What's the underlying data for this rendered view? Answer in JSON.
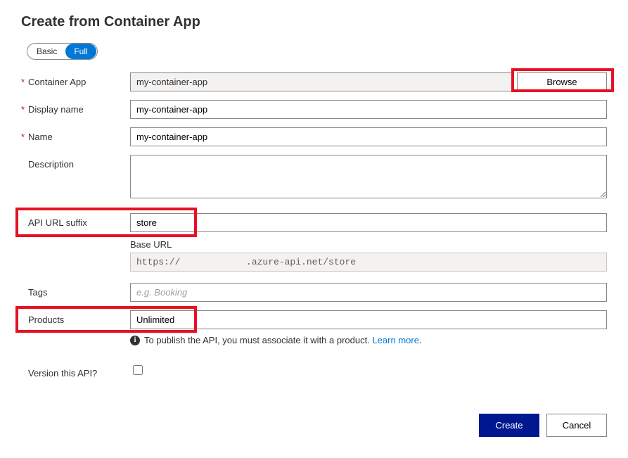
{
  "page": {
    "title": "Create from Container App"
  },
  "toggle": {
    "basic": "Basic",
    "full": "Full"
  },
  "labels": {
    "containerApp": "Container App",
    "displayName": "Display name",
    "name": "Name",
    "description": "Description",
    "apiUrlSuffix": "API URL suffix",
    "baseUrl": "Base URL",
    "tags": "Tags",
    "products": "Products",
    "version": "Version this API?"
  },
  "values": {
    "containerApp": "my-container-app",
    "displayName": "my-container-app",
    "name": "my-container-app",
    "description": "",
    "apiUrlSuffix": "store",
    "baseUrl": "https://            .azure-api.net/store",
    "tagsPlaceholder": "e.g. Booking",
    "products": "Unlimited"
  },
  "buttons": {
    "browse": "Browse",
    "create": "Create",
    "cancel": "Cancel"
  },
  "note": {
    "text": "To publish the API, you must associate it with a product. ",
    "link": "Learn more"
  }
}
